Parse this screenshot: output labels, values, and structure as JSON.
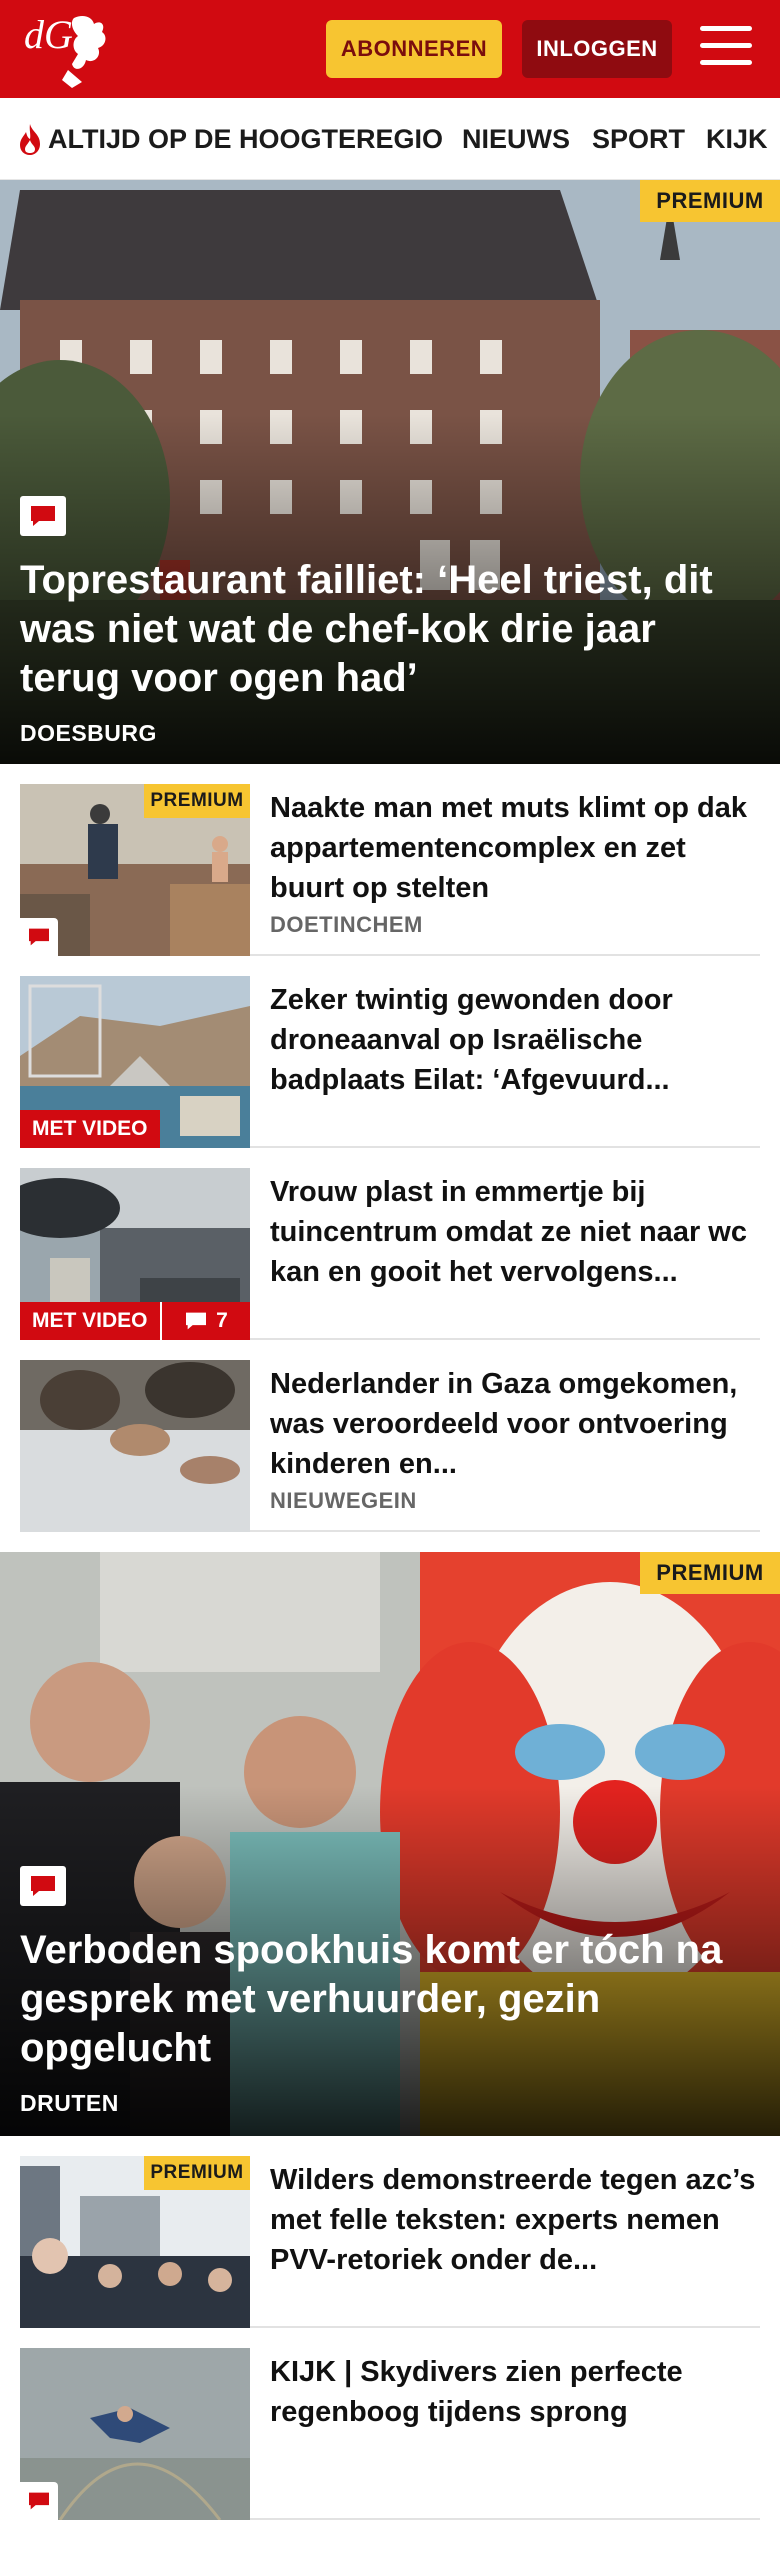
{
  "header": {
    "logo_text": "dG",
    "subscribe_label": "ABONNEREN",
    "login_label": "INLOGGEN",
    "menu_icon": "hamburger-icon",
    "brand_color": "#d10a11",
    "accent_color": "#f7c531"
  },
  "nav": {
    "items": [
      {
        "label": "ALTIJD OP DE HOOGTE",
        "icon": "flame-icon"
      },
      {
        "label": "REGIO"
      },
      {
        "label": "NIEUWS"
      },
      {
        "label": "SPORT"
      },
      {
        "label": "KIJK"
      }
    ]
  },
  "hero1": {
    "premium": "PREMIUM",
    "title": "Toprestaurant failliet: ‘Heel triest, dit was niet wat de chef-kok drie jaar terug voor ogen had’",
    "place": "DOESBURG"
  },
  "articles": [
    {
      "title": "Naakte man met muts klimt op dak appartementencomplex en zet buurt op stelten",
      "place": "DOETINCHEM",
      "premium": "PREMIUM"
    },
    {
      "title": "Zeker twintig gewonden door droneaanval op Israëlische badplaats Eilat: ‘Afgevuurd...",
      "video": "MET VIDEO"
    },
    {
      "title": "Vrouw plast in emmertje bij tuincentrum omdat ze niet naar wc kan en gooit het vervolgens...",
      "video": "MET VIDEO",
      "comments": "7"
    },
    {
      "title": "Nederlander in Gaza omgekomen, was veroordeeld voor ontvoering kinderen en...",
      "place": "NIEUWEGEIN"
    }
  ],
  "hero2": {
    "premium": "PREMIUM",
    "title": "Verboden spookhuis komt er tóch na gesprek met verhuurder, gezin opgelucht",
    "place": "DRUTEN"
  },
  "articles2": [
    {
      "title": "Wilders demonstreerde tegen azc’s met felle teksten: experts nemen PVV-retoriek onder de...",
      "premium": "PREMIUM"
    },
    {
      "title": "KIJK | Skydivers zien perfecte regenboog tijdens sprong"
    }
  ]
}
